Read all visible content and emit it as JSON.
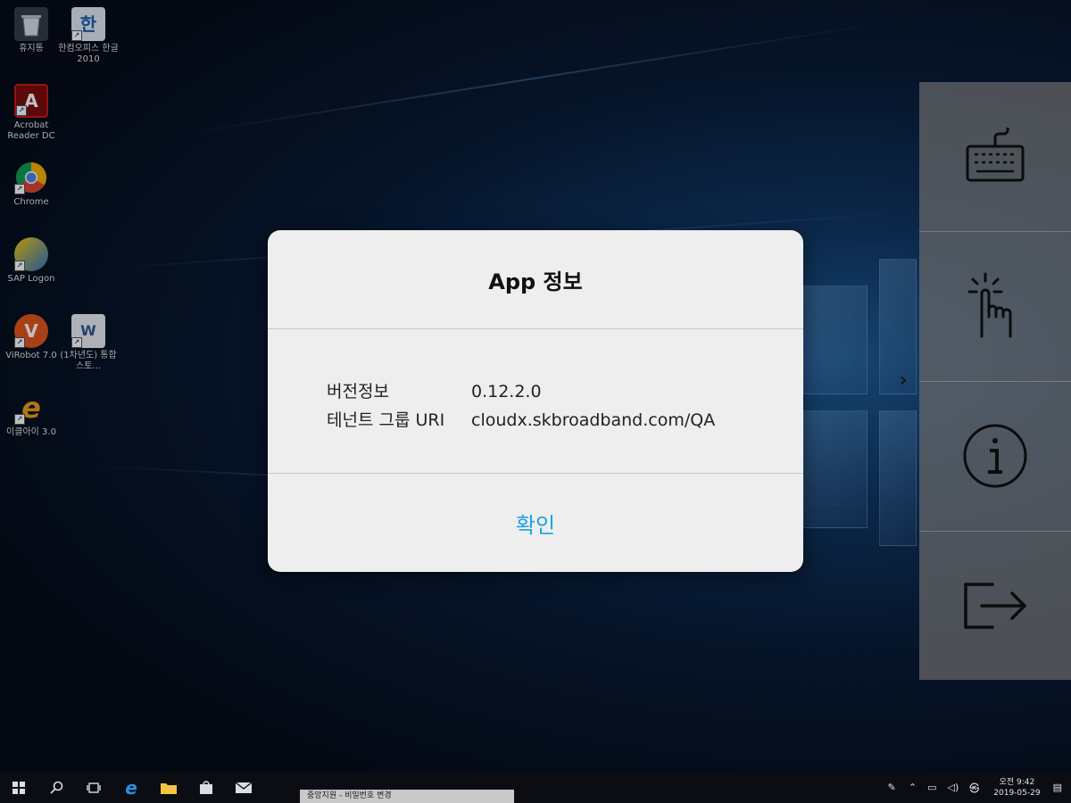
{
  "desktop": {
    "icons": [
      {
        "label": "휴지통",
        "icon": "recycle-bin-icon"
      },
      {
        "label": "한컴오피스 한글 2010",
        "icon": "hancom-icon"
      },
      {
        "label": "Acrobat Reader DC",
        "icon": "acrobat-icon"
      },
      {
        "label": "Chrome",
        "icon": "chrome-icon"
      },
      {
        "label": "SAP Logon",
        "icon": "sap-icon"
      },
      {
        "label": "ViRobot 7.0",
        "icon": "virobot-icon"
      },
      {
        "label": "(1차년도) 통합 스토...",
        "icon": "document-icon"
      },
      {
        "label": "이클아이 3.0",
        "icon": "ie-icon"
      }
    ]
  },
  "side_panel": {
    "buttons": [
      {
        "icon": "keyboard-icon"
      },
      {
        "icon": "touch-icon"
      },
      {
        "icon": "info-icon"
      },
      {
        "icon": "exit-icon"
      }
    ],
    "collapse": {
      "icon": "chevron-right-icon"
    }
  },
  "dialog": {
    "title": "App 정보",
    "rows": [
      {
        "key": "버전정보",
        "value": "0.12.2.0"
      },
      {
        "key": "테넌트 그룹 URI",
        "value": "cloudx.skbroadband.com/QA"
      }
    ],
    "confirm_label": "확인",
    "accent": "#1aa3e0"
  },
  "taskbar": {
    "icons": [
      "windows-start-icon",
      "search-icon",
      "task-view-icon",
      "edge-icon",
      "file-explorer-icon",
      "store-icon",
      "mail-icon"
    ],
    "active_window": "중앙지원 - 비밀번호 변경",
    "clock_time": "오전 9:42",
    "clock_date": "2019-05-29"
  }
}
